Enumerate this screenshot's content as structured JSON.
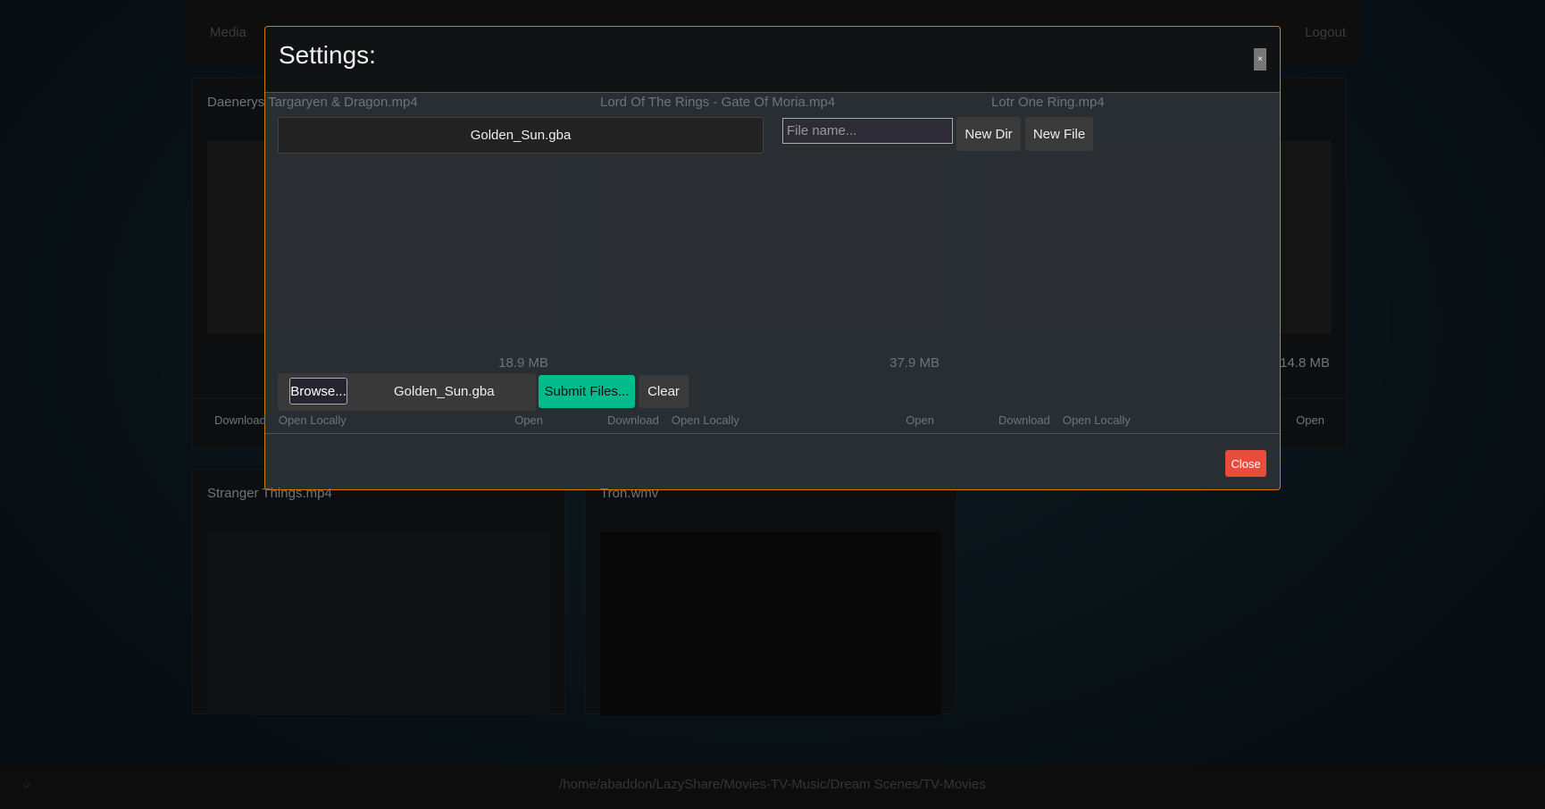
{
  "background": {
    "nav": {
      "media_label": "Media",
      "logout_label": "Logout"
    },
    "cards": [
      {
        "title": "Daenerys Targaryen & Dragon.mp4",
        "size": "18.9 MB",
        "actions": [
          "Download",
          "Open Locally"
        ],
        "open": "Open"
      },
      {
        "title": "Lord Of The Rings - Gate Of Moria.mp4",
        "size": "37.9 MB",
        "actions": [
          "Download",
          "Open Locally"
        ],
        "open": "Open"
      },
      {
        "title": "Lotr One Ring.mp4",
        "size": "14.8 MB",
        "actions": [
          "Download",
          "Open Locally"
        ],
        "open": "Open"
      },
      {
        "title": "Stranger Things.mp4"
      },
      {
        "title": "Tron.wmv"
      }
    ],
    "status": {
      "path": "/home/abaddon/LazyShare/Movies-TV-Music/Dream Scenes/TV-Movies",
      "star": "☆"
    }
  },
  "modal": {
    "title": "Settings:",
    "close_x": "×",
    "selected_file": "Golden_Sun.gba",
    "file_name_placeholder": "File name...",
    "new_dir": "New Dir",
    "new_file": "New File",
    "browse": "Browse...",
    "upload_file": "Golden_Sun.gba",
    "submit": "Submit Files...",
    "clear": "Clear",
    "close": "Close",
    "colors": {
      "accent_border": "#d97a00",
      "submit": "#00bc8c",
      "close": "#e74c3c"
    }
  }
}
